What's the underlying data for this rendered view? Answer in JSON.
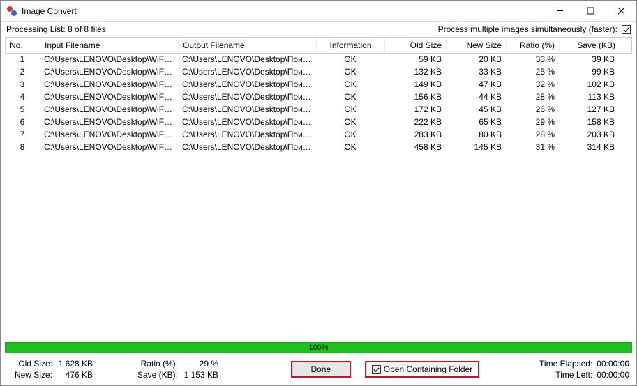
{
  "window": {
    "title": "Image Convert"
  },
  "topbar": {
    "processing_list": "Processing List: 8 of 8 files",
    "parallel_label": "Process multiple images simultaneously (faster):",
    "parallel_checked": true
  },
  "columns": {
    "no": "No.",
    "input": "Input Filename",
    "output": "Output Filename",
    "info": "Information",
    "old": "Old Size",
    "new": "New Size",
    "ratio": "Ratio (%)",
    "save": "Save (KB)"
  },
  "rows": [
    {
      "no": "1",
      "input": "C:\\Users\\LENOVO\\Desktop\\WiFiGiD...",
      "output": "C:\\Users\\LENOVO\\Desktop\\Поиск\\Ф...",
      "info": "OK",
      "old": "59 KB",
      "new": "20 KB",
      "ratio": "33 %",
      "save": "39 KB"
    },
    {
      "no": "2",
      "input": "C:\\Users\\LENOVO\\Desktop\\WiFiGiD...",
      "output": "C:\\Users\\LENOVO\\Desktop\\Поиск\\Ф...",
      "info": "OK",
      "old": "132 KB",
      "new": "33 KB",
      "ratio": "25 %",
      "save": "99 KB"
    },
    {
      "no": "3",
      "input": "C:\\Users\\LENOVO\\Desktop\\WiFiGiD...",
      "output": "C:\\Users\\LENOVO\\Desktop\\Поиск\\Ф...",
      "info": "OK",
      "old": "149 KB",
      "new": "47 KB",
      "ratio": "32 %",
      "save": "102 KB"
    },
    {
      "no": "4",
      "input": "C:\\Users\\LENOVO\\Desktop\\WiFiGiD...",
      "output": "C:\\Users\\LENOVO\\Desktop\\Поиск\\Ф...",
      "info": "OK",
      "old": "156 KB",
      "new": "44 KB",
      "ratio": "28 %",
      "save": "113 KB"
    },
    {
      "no": "5",
      "input": "C:\\Users\\LENOVO\\Desktop\\WiFiGiD...",
      "output": "C:\\Users\\LENOVO\\Desktop\\Поиск\\Ф...",
      "info": "OK",
      "old": "172 KB",
      "new": "45 KB",
      "ratio": "26 %",
      "save": "127 KB"
    },
    {
      "no": "6",
      "input": "C:\\Users\\LENOVO\\Desktop\\WiFiGiD...",
      "output": "C:\\Users\\LENOVO\\Desktop\\Поиск\\Ф...",
      "info": "OK",
      "old": "222 KB",
      "new": "65 KB",
      "ratio": "29 %",
      "save": "158 KB"
    },
    {
      "no": "7",
      "input": "C:\\Users\\LENOVO\\Desktop\\WiFiGiD...",
      "output": "C:\\Users\\LENOVO\\Desktop\\Поиск\\Ф...",
      "info": "OK",
      "old": "283 KB",
      "new": "80 KB",
      "ratio": "28 %",
      "save": "203 KB"
    },
    {
      "no": "8",
      "input": "C:\\Users\\LENOVO\\Desktop\\WiFiGiD...",
      "output": "C:\\Users\\LENOVO\\Desktop\\Поиск\\Ф...",
      "info": "OK",
      "old": "458 KB",
      "new": "145 KB",
      "ratio": "31 %",
      "save": "314 KB"
    }
  ],
  "progress": {
    "percent_text": "100%",
    "percent_value": 100
  },
  "footer": {
    "old_size_label": "Old Size:",
    "old_size_value": "1 628 KB",
    "new_size_label": "New Size:",
    "new_size_value": "476 KB",
    "ratio_label": "Ratio (%):",
    "ratio_value": "29 %",
    "save_label": "Save (KB):",
    "save_value": "1 153 KB",
    "done_label": "Done",
    "open_folder_label": "Open Containing Folder",
    "open_folder_checked": true,
    "time_elapsed_label": "Time Elapsed:",
    "time_elapsed_value": "00:00:00",
    "time_left_label": "Time Left:",
    "time_left_value": "00:00:00"
  }
}
